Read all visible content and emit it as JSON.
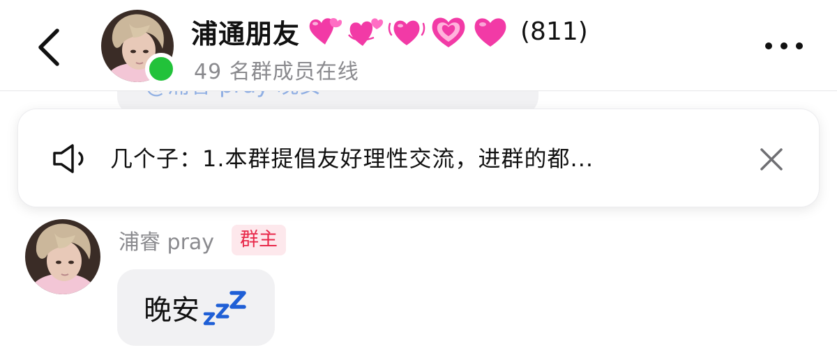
{
  "header": {
    "back_icon": "chevron-left-icon",
    "group_name": "浦通朋友",
    "emojis": [
      "two-hearts",
      "revolving-hearts",
      "beating-heart",
      "growing-heart",
      "pink-heart"
    ],
    "member_count": "(811)",
    "online_status": "49 名群成员在线",
    "more_icon": "more-horizontal-icon"
  },
  "previous_message": {
    "partial_text": "@浦睿 pray 晚安"
  },
  "announcement": {
    "icon": "speaker-icon",
    "text": "几个子：1.本群提倡友好理性交流，进群的都...",
    "close_icon": "close-icon"
  },
  "message": {
    "sender_name": "浦睿 pray",
    "role_badge": "群主",
    "text": "晚安",
    "emoji": "zzz-icon"
  },
  "colors": {
    "online": "#22c23a",
    "badge_bg": "#fde8ec",
    "badge_text": "#e8294a",
    "bubble_bg": "#f1f1f3",
    "heart_pink": "#f23aa6",
    "zzz_blue": "#1f5fd6"
  }
}
